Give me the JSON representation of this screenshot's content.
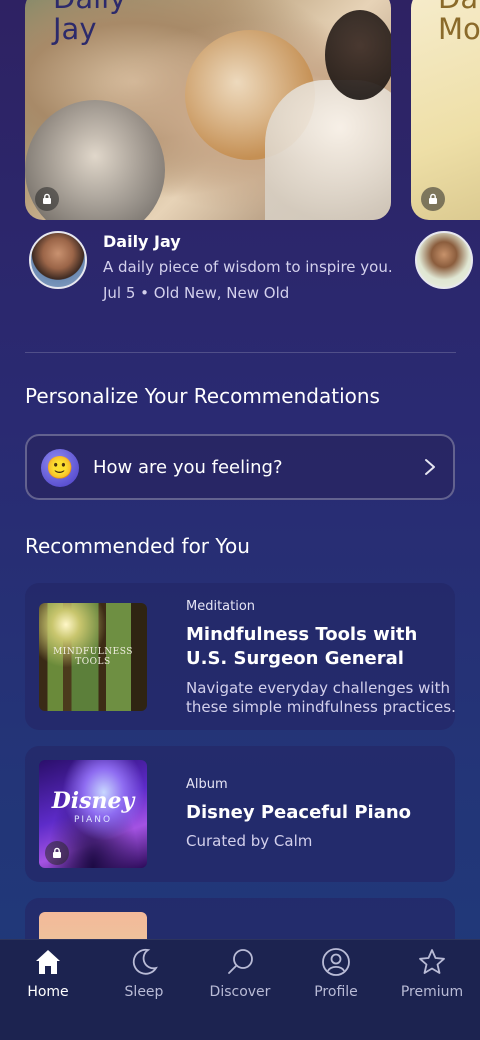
{
  "carousel": [
    {
      "title_line1": "Daily",
      "title_line2": "Jay",
      "locked": true
    },
    {
      "title_line1": "Da",
      "title_line2": "Mo",
      "locked": true
    }
  ],
  "featured": {
    "name": "Daily Jay",
    "description": "A daily piece of wisdom to inspire you.",
    "meta": "Jul 5 • Old New, New Old"
  },
  "personalize": {
    "section_title": "Personalize Your Recommendations",
    "prompt": "How are you feeling?",
    "emoji": "🙂"
  },
  "recommended": {
    "section_title": "Recommended for You",
    "items": [
      {
        "kind": "Meditation",
        "title": "Mindfulness Tools with U.S. Surgeon General",
        "description": "Navigate everyday challenges with these simple mindfulness practices.",
        "thumb_text": "MINDFULNESS TOOLS",
        "locked": false
      },
      {
        "kind": "Album",
        "title": "Disney Peaceful Piano",
        "description": "Curated by Calm",
        "thumb_brand": "Disney",
        "thumb_sub": "PIANO",
        "locked": true
      }
    ]
  },
  "tabbar": [
    {
      "label": "Home",
      "icon": "home-icon",
      "active": true
    },
    {
      "label": "Sleep",
      "icon": "moon-icon",
      "active": false
    },
    {
      "label": "Discover",
      "icon": "magnifier-icon",
      "active": false
    },
    {
      "label": "Profile",
      "icon": "person-icon",
      "active": false
    },
    {
      "label": "Premium",
      "icon": "star-icon",
      "active": false
    }
  ]
}
